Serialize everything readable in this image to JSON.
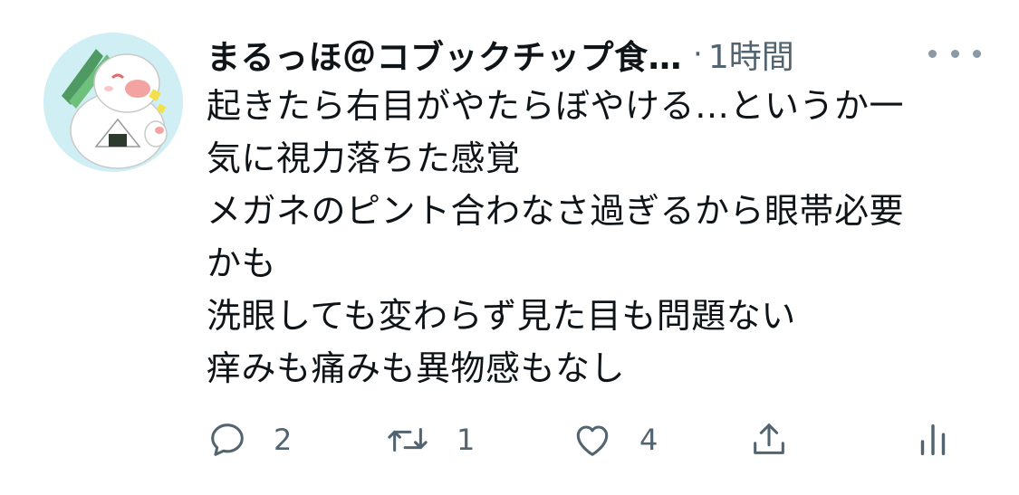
{
  "author": {
    "display_name": "まるっほ＠コブックチップ食…",
    "separator": "·",
    "timestamp": "1時間"
  },
  "tweet": {
    "lines": [
      "起きたら右目がやたらぼやける…というか一",
      "気に視力落ちた感覚",
      "メガネのピント合わなさ過ぎるから眼帯必要",
      "かも",
      "洗眼しても変わらず見た目も問題ない",
      "痒みも痛みも異物感もなし"
    ]
  },
  "actions": {
    "reply": {
      "icon": "reply-icon",
      "count": "2"
    },
    "retweet": {
      "icon": "retweet-icon",
      "count": "1"
    },
    "like": {
      "icon": "heart-icon",
      "count": "4"
    },
    "share": {
      "icon": "share-icon"
    },
    "views": {
      "icon": "views-icon"
    }
  },
  "colors": {
    "text": "#0f1419",
    "secondary": "#536471",
    "avatar_bg": "#cfeff5"
  }
}
